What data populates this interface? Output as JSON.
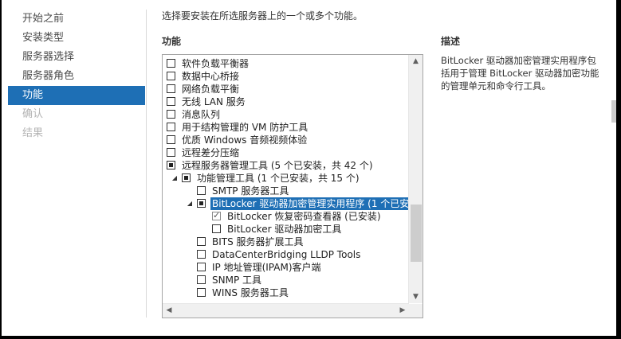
{
  "nav": {
    "items": [
      {
        "label": "开始之前",
        "state": "normal"
      },
      {
        "label": "安装类型",
        "state": "normal"
      },
      {
        "label": "服务器选择",
        "state": "normal"
      },
      {
        "label": "服务器角色",
        "state": "normal"
      },
      {
        "label": "功能",
        "state": "active"
      },
      {
        "label": "确认",
        "state": "disabled"
      },
      {
        "label": "结果",
        "state": "disabled"
      }
    ]
  },
  "main": {
    "instruction": "选择要安装在所选服务器上的一个或多个功能。",
    "features_heading": "功能",
    "description_heading": "描述",
    "description_text": "BitLocker 驱动器加密管理实用程序包括用于管理 BitLocker 驱动器加密功能的管理单元和命令行工具。"
  },
  "tree": {
    "rows": [
      {
        "label": "软件负载平衡器",
        "state": "unchecked",
        "level": 0
      },
      {
        "label": "数据中心桥接",
        "state": "unchecked",
        "level": 0
      },
      {
        "label": "网络负载平衡",
        "state": "unchecked",
        "level": 0
      },
      {
        "label": "无线 LAN 服务",
        "state": "unchecked",
        "level": 0
      },
      {
        "label": "消息队列",
        "state": "unchecked",
        "level": 0
      },
      {
        "label": "用于结构管理的 VM 防护工具",
        "state": "unchecked",
        "level": 0
      },
      {
        "label": "优质 Windows 音频视频体验",
        "state": "unchecked",
        "level": 0
      },
      {
        "label": "远程差分压缩",
        "state": "unchecked",
        "level": 0
      },
      {
        "label": "远程服务器管理工具 (5 个已安装，共 42 个)",
        "state": "partial",
        "level": 0
      },
      {
        "label": "功能管理工具 (1 个已安装，共 15 个)",
        "state": "partial",
        "level": 1,
        "expanded": true
      },
      {
        "label": "SMTP 服务器工具",
        "state": "unchecked",
        "level": 2
      },
      {
        "label": "BitLocker 驱动器加密管理实用程序 (1 个已安装",
        "state": "partial",
        "level": 2,
        "expanded": true,
        "selected": true
      },
      {
        "label": "BitLocker 恢复密码查看器 (已安装)",
        "state": "checked",
        "level": 3
      },
      {
        "label": "BitLocker 驱动器加密工具",
        "state": "unchecked",
        "level": 3
      },
      {
        "label": "BITS 服务器扩展工具",
        "state": "unchecked",
        "level": 2
      },
      {
        "label": "DataCenterBridging LLDP Tools",
        "state": "unchecked",
        "level": 2
      },
      {
        "label": "IP 地址管理(IPAM)客户端",
        "state": "unchecked",
        "level": 2
      },
      {
        "label": "SNMP 工具",
        "state": "unchecked",
        "level": 2
      },
      {
        "label": "WINS 服务器工具",
        "state": "unchecked",
        "level": 2
      }
    ]
  },
  "scroll": {
    "up": "▲",
    "down": "▼",
    "left": "◀",
    "right": "▶",
    "expanded_glyph": "◢"
  },
  "colors": {
    "accent": "#1e6fb5",
    "disabled_text": "#b4b4b4"
  }
}
